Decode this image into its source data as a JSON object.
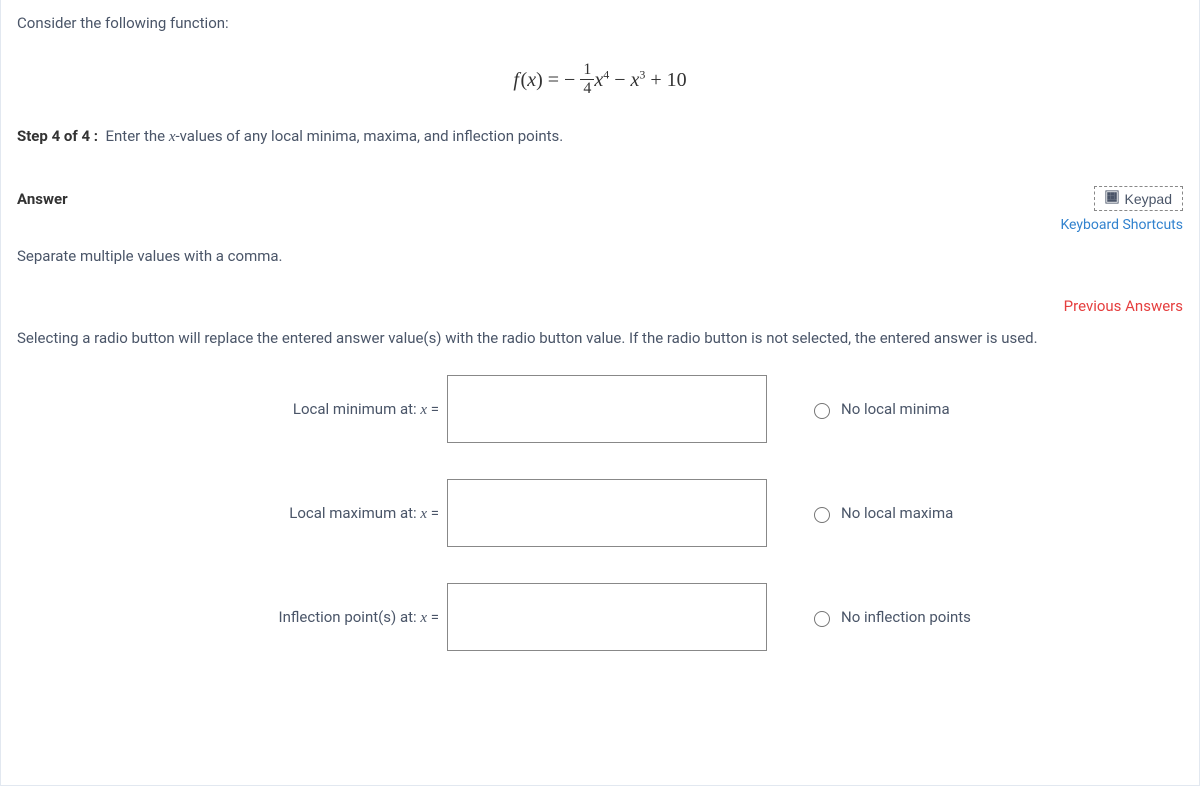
{
  "question": {
    "prompt": "Consider the following function:",
    "equation_plain": "f(x) = -(1/4)x^4 - x^3 + 10",
    "step_label": "Step 4 of 4 :",
    "step_text_before_x": "Enter the ",
    "step_text_after_x": "-values of any local minima, maxima, and inflection points."
  },
  "answer_section": {
    "title": "Answer",
    "keypad_label": "Keypad",
    "keyboard_shortcuts_label": "Keyboard Shortcuts",
    "hint": "Separate multiple values with a comma.",
    "previous_answers_label": "Previous Answers",
    "radio_hint": "Selecting a radio button will replace the entered answer value(s) with the radio button value. If the radio button is not selected, the entered answer is used."
  },
  "rows": [
    {
      "label_prefix": "Local minimum at: ",
      "var": "x",
      "eq": " =",
      "value": "",
      "radio_label": "No local minima"
    },
    {
      "label_prefix": "Local maximum at: ",
      "var": "x",
      "eq": " =",
      "value": "",
      "radio_label": "No local maxima"
    },
    {
      "label_prefix": "Inflection point(s) at: ",
      "var": "x",
      "eq": " =",
      "value": "",
      "radio_label": "No inflection points"
    }
  ]
}
